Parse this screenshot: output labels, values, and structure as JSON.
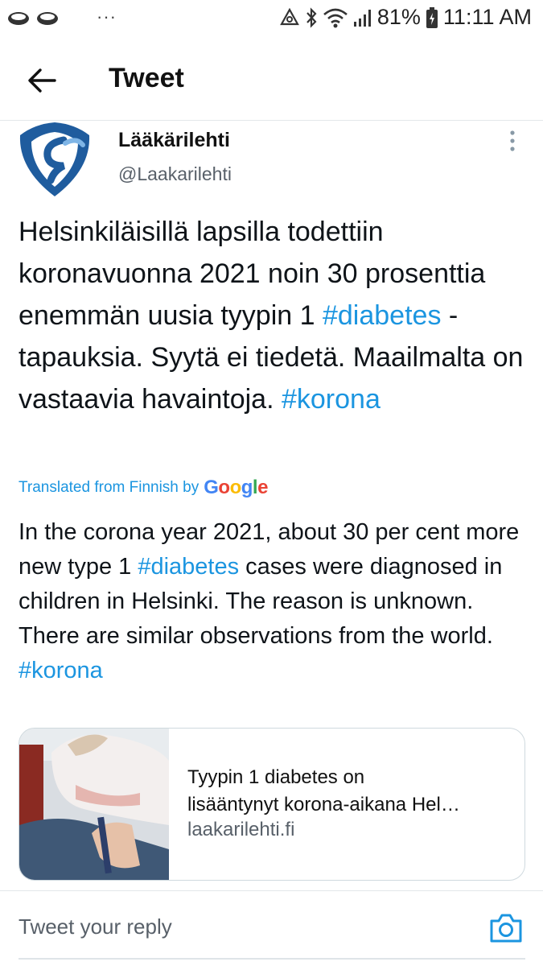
{
  "status_bar": {
    "battery": "81%",
    "time": "11:11 AM",
    "dots": "···"
  },
  "header": {
    "title": "Tweet"
  },
  "author": {
    "name": "Lääkärilehti",
    "handle": "@Laakarilehti"
  },
  "tweet": {
    "segments": [
      {
        "text": "Helsinkiläisillä lapsilla todettiin koronavuonna 2021 noin 30 prosenttia enemmän uusia tyypin 1 ",
        "hashtag": false
      },
      {
        "text": "#diabetes",
        "hashtag": true
      },
      {
        "text": " -tapauksia. Syytä ei tiedetä. Maailmalta on vastaavia havaintoja. ",
        "hashtag": false
      },
      {
        "text": "#korona",
        "hashtag": true
      }
    ]
  },
  "translation": {
    "label": "Translated from Finnish by",
    "provider": "Google",
    "segments": [
      {
        "text": "In the corona year 2021, about 30 per cent more new type 1 ",
        "hashtag": false
      },
      {
        "text": "#diabetes",
        "hashtag": true
      },
      {
        "text": " cases were diagnosed in children in Helsinki. The reason is unknown. There are similar observations from the world. ",
        "hashtag": false
      },
      {
        "text": "#korona",
        "hashtag": true
      }
    ]
  },
  "link_card": {
    "title_line1": "Tyypin 1 diabetes on",
    "title_line2": "lisääntynyt korona-aikana Hel…",
    "domain": "laakarilehti.fi"
  },
  "reply": {
    "placeholder": "Tweet your reply"
  },
  "colors": {
    "accent": "#1b95e0",
    "text": "#0f1419",
    "secondary": "#586069",
    "logo_blue": "#1f5c9e"
  }
}
